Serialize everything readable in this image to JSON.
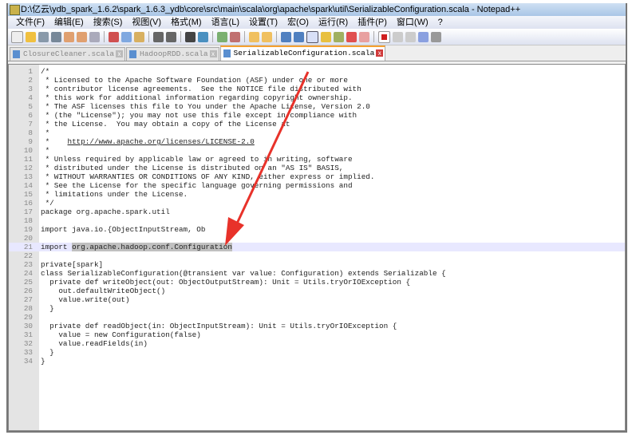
{
  "title": "D:\\亿云\\ydb_spark_1.6.2\\spark_1.6.3_ydb\\core\\src\\main\\scala\\org\\apache\\spark\\util\\SerializableConfiguration.scala - Notepad++",
  "menu": [
    "文件(F)",
    "编辑(E)",
    "搜索(S)",
    "视图(V)",
    "格式(M)",
    "语言(L)",
    "设置(T)",
    "宏(O)",
    "运行(R)",
    "插件(P)",
    "窗口(W)",
    "?"
  ],
  "tabs": [
    {
      "label": "ClosureCleaner.scala"
    },
    {
      "label": "HadoopRDD.scala"
    },
    {
      "label": "SerializableConfiguration.scala"
    }
  ],
  "colors": {
    "arrow": "#e8322a",
    "tab_active": "#f5a030"
  },
  "code": {
    "l1": "/*",
    "l2": " * Licensed to the Apache Software Foundation (ASF) under one or more",
    "l3": " * contributor license agreements.  See the NOTICE file distributed with",
    "l4": " * this work for additional information regarding copyright ownership.",
    "l5": " * The ASF licenses this file to You under the Apache License, Version 2.0",
    "l6": " * (the \"License\"); you may not use this file except in compliance with",
    "l7": " * the License.  You may obtain a copy of the License at",
    "l8": " *",
    "l9a": " *    ",
    "l9b": "http://www.apache.org/licenses/LICENSE-2.0",
    "l10": " *",
    "l11": " * Unless required by applicable law or agreed to in writing, software",
    "l12": " * distributed under the License is distributed on an \"AS IS\" BASIS,",
    "l13": " * WITHOUT WARRANTIES OR CONDITIONS OF ANY KIND, either express or implied.",
    "l14": " * See the License for the specific language governing permissions and",
    "l15": " * limitations under the License.",
    "l16": " */",
    "l17": "package org.apache.spark.util",
    "l18": "",
    "l19": "import java.io.{ObjectInputStream, Ob",
    "l20": "",
    "l21a": "import ",
    "l21b": "org.apache.hadoop.conf.Configuration",
    "l22": "",
    "l23": "private[spark]",
    "l24": "class SerializableConfiguration(@transient var value: Configuration) extends Serializable {",
    "l25": "  private def writeObject(out: ObjectOutputStream): Unit = Utils.tryOrIOException {",
    "l26": "    out.defaultWriteObject()",
    "l27": "    value.write(out)",
    "l28": "  }",
    "l29": "",
    "l30": "  private def readObject(in: ObjectInputStream): Unit = Utils.tryOrIOException {",
    "l31": "    value = new Configuration(false)",
    "l32": "    value.readFields(in)",
    "l33": "  }",
    "l34": "}"
  }
}
